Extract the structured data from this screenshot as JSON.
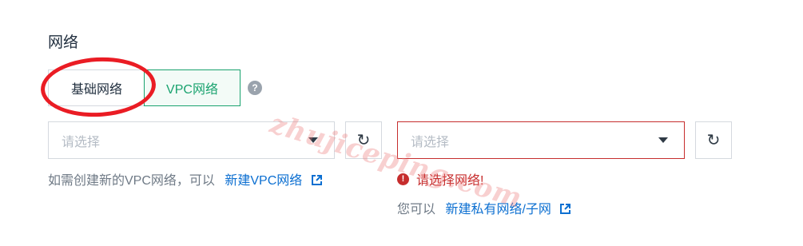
{
  "section": {
    "title": "网络"
  },
  "network_type": {
    "options": [
      {
        "label": "基础网络",
        "selected": false
      },
      {
        "label": "VPC网络",
        "selected": true
      }
    ],
    "help_icon": "question-circle-icon"
  },
  "vpc_select": {
    "placeholder": "请选择",
    "hint_text": "如需创建新的VPC网络，可以",
    "hint_link": "新建VPC网络"
  },
  "subnet_select": {
    "placeholder": "请选择",
    "error_text": "请选择网络!",
    "hint_text": "您可以",
    "hint_link": "新建私有网络/子网"
  },
  "watermark": "zhujiceping.com",
  "colors": {
    "accent_green": "#1aa36f",
    "error_red": "#c62d2d",
    "link_blue": "#0c6fd1",
    "annotation_red": "#ea1c24"
  }
}
